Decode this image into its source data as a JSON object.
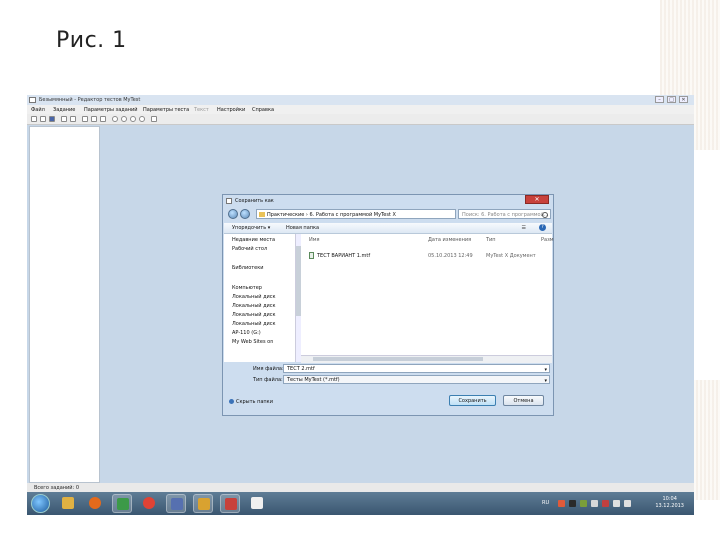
{
  "slide": {
    "title": "Рис. 1"
  },
  "app": {
    "window_title": "Безымянный - Редактор тестов MyTest",
    "window_buttons": [
      "–",
      "□",
      "✕"
    ],
    "menu": [
      "Файл",
      "Задание",
      "Параметры заданий",
      "Параметры теста",
      "Текст",
      "Настройки",
      "Справка"
    ],
    "toolbar_icons": [
      "new-icon",
      "open-icon",
      "save-icon",
      "undo-icon",
      "redo-icon",
      "cut-icon",
      "copy-icon",
      "paste-icon",
      "print-icon",
      "globe-icon",
      "settings-icon",
      "help-icon",
      "info-icon"
    ],
    "status": "Всего заданий: 0"
  },
  "dialog": {
    "title": "Сохранить как",
    "close_label": "✕",
    "address_path": "Практические › 6. Работа с программой MyTest X",
    "search_placeholder": "Поиск: 6. Работа с программой...",
    "command_bar": {
      "organize": "Упорядочить ▾",
      "new_folder": "Новая папка"
    },
    "nav_items": [
      {
        "label": "Недавние места",
        "color": "#5a7fb0"
      },
      {
        "label": "Рабочий стол",
        "color": "#3c6ea8"
      },
      {
        "label": "Библиотеки",
        "color": "#c89a3c"
      },
      {
        "label": "Компьютер",
        "color": "#5a6f88"
      },
      {
        "label": "Локальный диск",
        "color": "#8a96a6"
      },
      {
        "label": "Локальный диск",
        "color": "#8a96a6"
      },
      {
        "label": "Локальный диск",
        "color": "#8a96a6"
      },
      {
        "label": "Локальный диск",
        "color": "#8a96a6"
      },
      {
        "label": "AP-110 (G:)",
        "color": "#8a96a6"
      },
      {
        "label": "My Web Sites on",
        "color": "#d9862a"
      }
    ],
    "columns": [
      "Имя",
      "Дата изменения",
      "Тип",
      "Разм"
    ],
    "files": [
      {
        "name": "ТЕСТ ВАРИАНТ 1.mtf",
        "modified": "05.10.2013 12:49",
        "type": "MyTest X Документ"
      }
    ],
    "filename_label": "Имя файла:",
    "filename_value": "ТЕСТ 2.mtf",
    "filetype_label": "Тип файла:",
    "filetype_value": "Тесты MyTest (*.mtf)",
    "hide_folders": "Скрыть папки",
    "save_button": "Сохранить",
    "cancel_button": "Отмена"
  },
  "taskbar": {
    "apps": [
      {
        "name": "explorer-app-icon",
        "color": "#e0b143"
      },
      {
        "name": "firefox-app-icon",
        "color": "#e46a1c"
      },
      {
        "name": "mytest-app-icon",
        "color": "#3c9a48"
      },
      {
        "name": "chrome-app-icon",
        "color": "#e04234"
      },
      {
        "name": "save-app-icon",
        "color": "#5670b0"
      },
      {
        "name": "mytest-editor-app-icon",
        "color": "#d9a230"
      },
      {
        "name": "presentation-app-icon",
        "color": "#c8413b"
      },
      {
        "name": "paint-app-icon",
        "color": "#f0f0f0"
      }
    ],
    "lang": "RU",
    "time": "10:04",
    "date": "13.12.2013"
  }
}
